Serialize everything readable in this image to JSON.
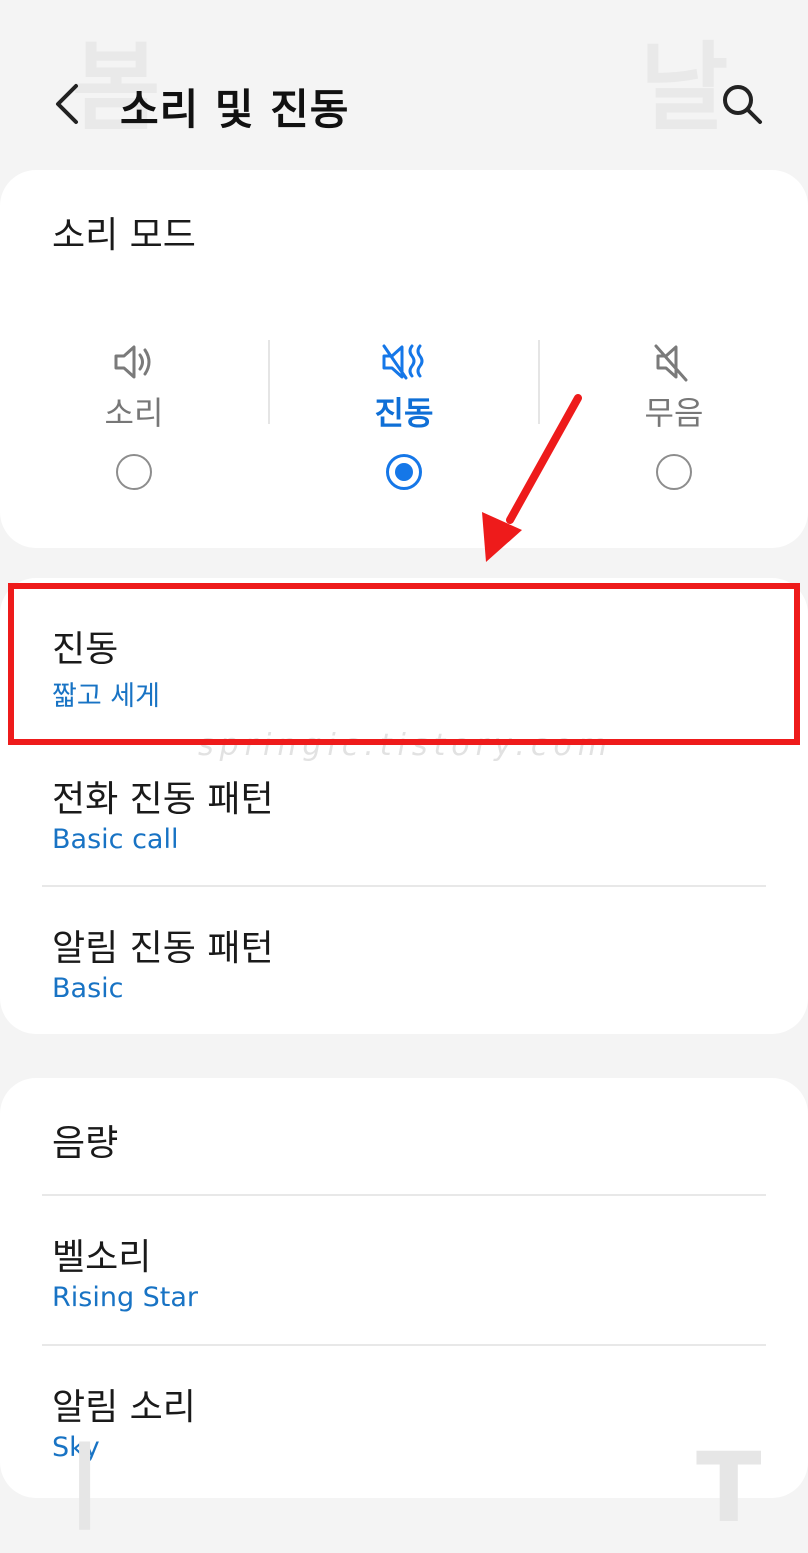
{
  "watermark": {
    "left_glyph": "봄",
    "right_glyph": "날",
    "bottom_left_glyph": "ㅣ",
    "bottom_right_glyph": "T",
    "url": "springic.tistory.com"
  },
  "header": {
    "back_icon": "chevron-left-icon",
    "title": "소리 및 진동",
    "search_icon": "search-icon"
  },
  "sound_mode": {
    "label": "소리 모드",
    "options": [
      {
        "label": "소리",
        "icon": "speaker-icon",
        "selected": false
      },
      {
        "label": "진동",
        "icon": "vibrate-icon",
        "selected": true
      },
      {
        "label": "무음",
        "icon": "mute-icon",
        "selected": false
      }
    ]
  },
  "vibration": {
    "items": [
      {
        "title": "진동",
        "value": "짧고 세게"
      },
      {
        "title": "전화 진동 패턴",
        "value": "Basic call"
      },
      {
        "title": "알림 진동 패턴",
        "value": "Basic"
      }
    ]
  },
  "volume": {
    "title": "음량",
    "items": [
      {
        "title": "벨소리",
        "value": "Rising Star"
      },
      {
        "title": "알림 소리",
        "value": "Sky"
      }
    ]
  },
  "colors": {
    "accent": "#1577e8",
    "value_text": "#1873c4",
    "highlight": "#ee1b1b",
    "background": "#f4f4f4",
    "card": "#ffffff"
  }
}
